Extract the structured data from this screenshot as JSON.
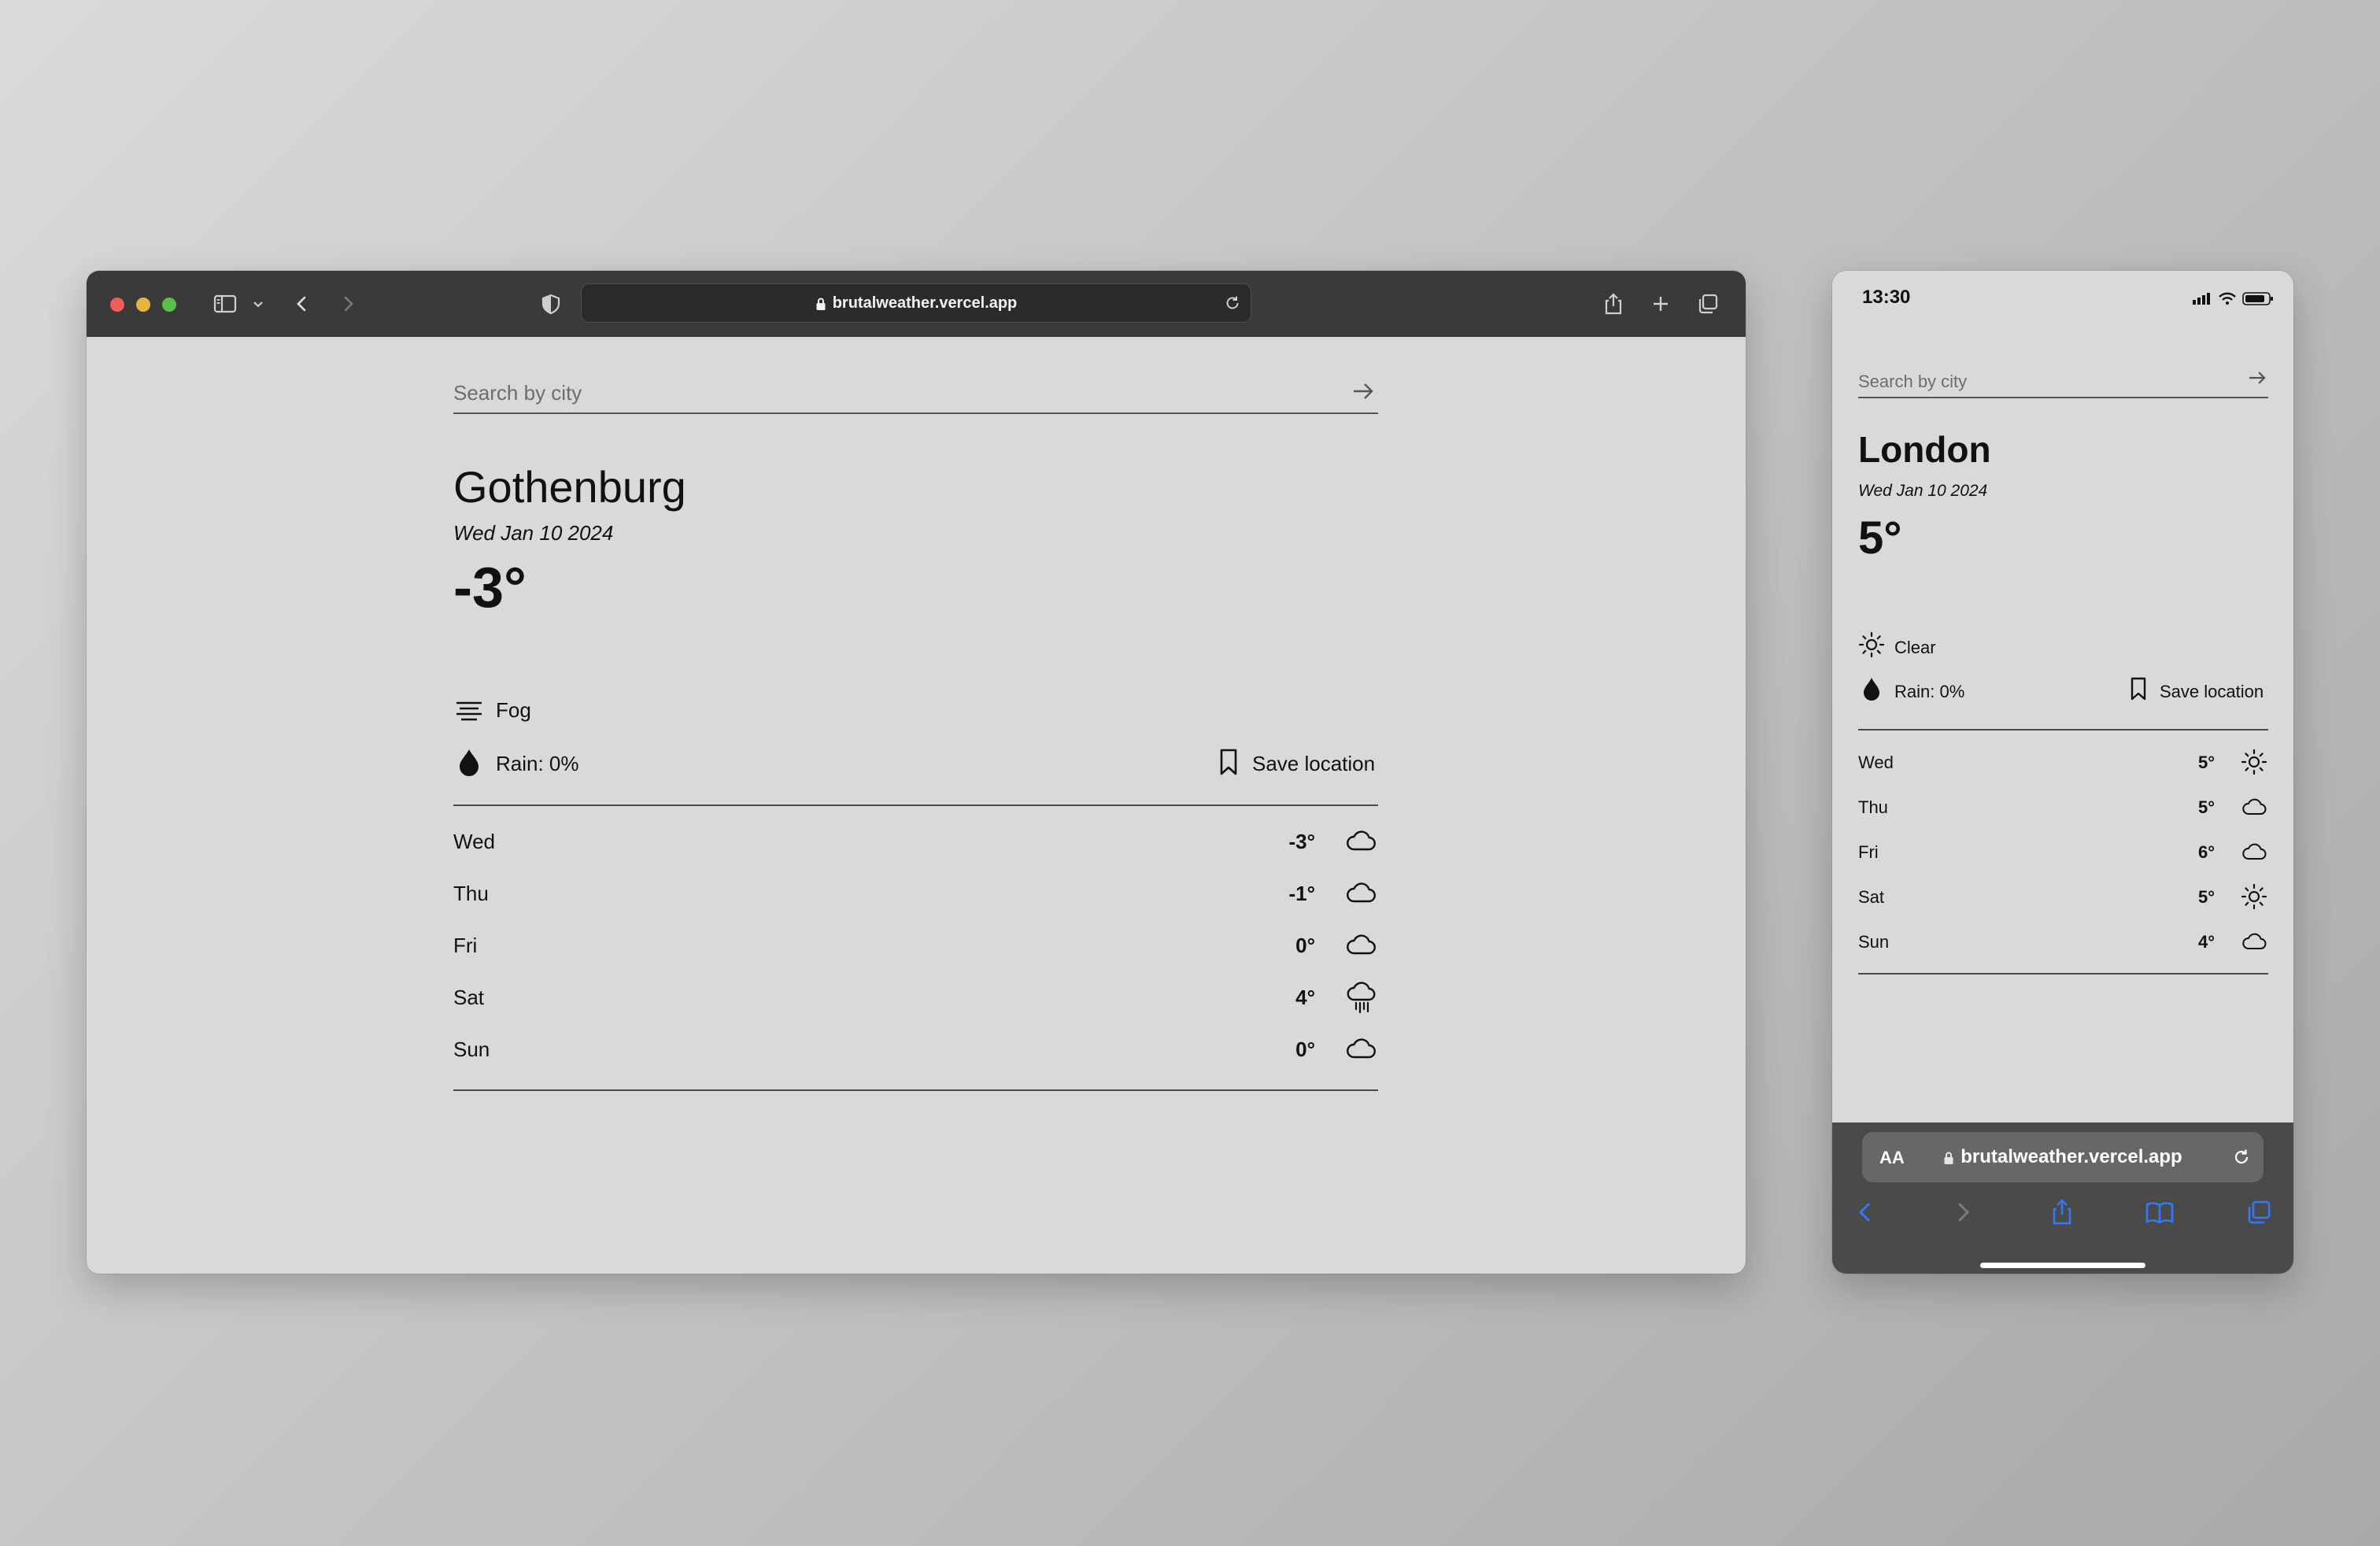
{
  "desktop": {
    "browser": {
      "url": "brutalweather.vercel.app"
    },
    "search": {
      "placeholder": "Search by city"
    },
    "location": {
      "city": "Gothenburg",
      "date": "Wed Jan 10 2024",
      "temperature": "-3°",
      "condition": {
        "label": "Fog",
        "icon": "fog-icon"
      },
      "rain": "Rain: 0%",
      "save_label": "Save location"
    },
    "forecast": [
      {
        "day": "Wed",
        "temp": "-3°",
        "icon": "cloud-icon"
      },
      {
        "day": "Thu",
        "temp": "-1°",
        "icon": "cloud-icon"
      },
      {
        "day": "Fri",
        "temp": "0°",
        "icon": "cloud-icon"
      },
      {
        "day": "Sat",
        "temp": "4°",
        "icon": "rain-cloud-icon"
      },
      {
        "day": "Sun",
        "temp": "0°",
        "icon": "cloud-icon"
      }
    ]
  },
  "mobile": {
    "status_time": "13:30",
    "search": {
      "placeholder": "Search by city"
    },
    "location": {
      "city": "London",
      "date": "Wed Jan 10 2024",
      "temperature": "5°",
      "condition": {
        "label": "Clear",
        "icon": "sun-icon"
      },
      "rain": "Rain: 0%",
      "save_label": "Save location"
    },
    "forecast": [
      {
        "day": "Wed",
        "temp": "5°",
        "icon": "sun-icon"
      },
      {
        "day": "Thu",
        "temp": "5°",
        "icon": "cloud-icon"
      },
      {
        "day": "Fri",
        "temp": "6°",
        "icon": "cloud-icon"
      },
      {
        "day": "Sat",
        "temp": "5°",
        "icon": "sun-icon"
      },
      {
        "day": "Sun",
        "temp": "4°",
        "icon": "cloud-icon"
      }
    ],
    "browser": {
      "text_size_label": "AA",
      "url": "brutalweather.vercel.app"
    }
  },
  "colors": {
    "page_bg": "#d9d9d9",
    "toolbar_bg": "#3a3a3a",
    "ios_accent": "#3478f6"
  }
}
